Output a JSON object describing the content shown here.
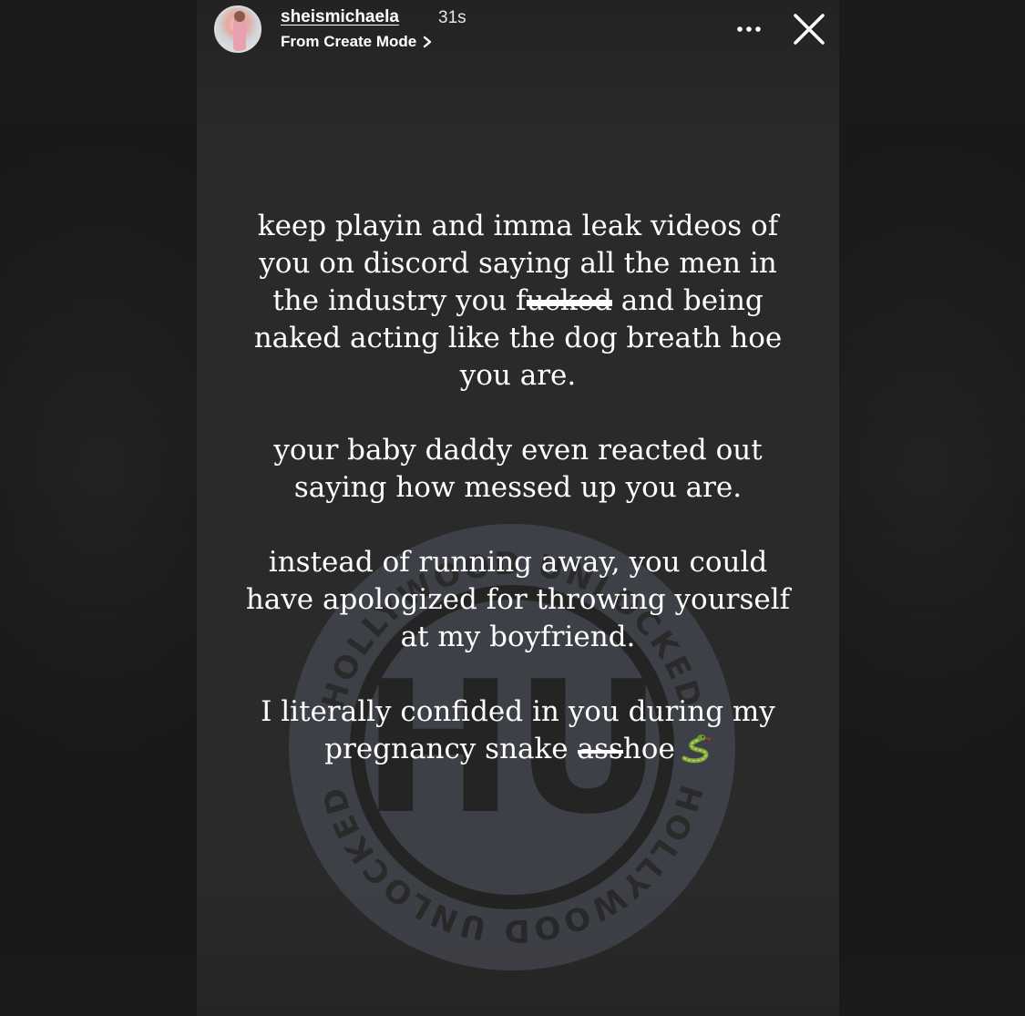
{
  "story": {
    "username": "sheismichaela",
    "timestamp": "31s",
    "subline": "From Create Mode",
    "paragraphs": [
      "keep playin and imma leak videos of you on discord saying all the men in the industry you f",
      "your baby daddy even reacted out saying how messed up you are.",
      "instead of running away, you could have apologized for throwing yourself at my boyfriend.",
      "I literally confided in you during my pregnancy snake "
    ],
    "p1_redacted": "ucked",
    "p1_rest": " and being naked acting like the dog breath hoe you are.",
    "p4_redacted": "ass",
    "p4_rest": "hoe",
    "emoji_icon": "snake-icon"
  },
  "watermark": {
    "text": "HOLLYWOOD UNLOCKED",
    "logo_letters": "HU"
  },
  "colors": {
    "story_bg": "#2a2a2a",
    "page_bg": "#151515",
    "text": "#ffffff"
  }
}
